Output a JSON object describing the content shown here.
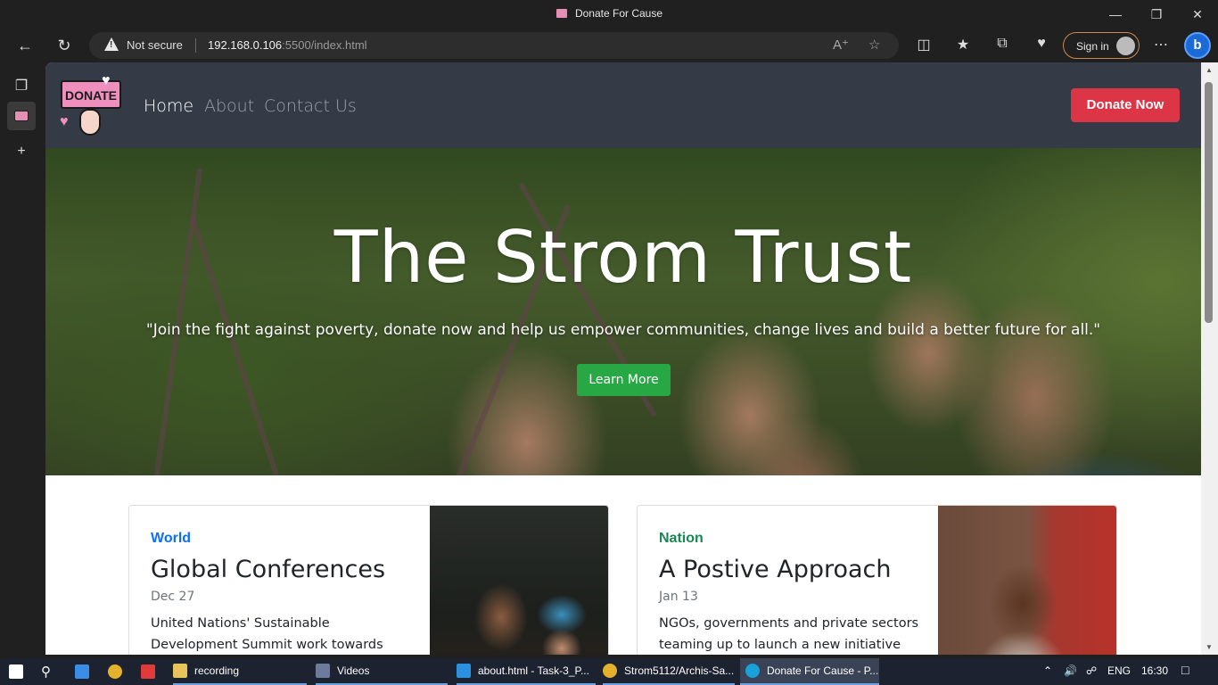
{
  "browser": {
    "window_title": "Donate For Cause",
    "security_label": "Not secure",
    "url_host": "192.168.0.106",
    "url_rest": ":5500/index.html",
    "signin_label": "Sign in"
  },
  "site": {
    "logo_text": "DONATE",
    "nav": [
      {
        "label": "Home",
        "active": true
      },
      {
        "label": "About",
        "active": false
      },
      {
        "label": "Contact Us",
        "active": false
      }
    ],
    "cta_label": "Donate Now"
  },
  "hero": {
    "title": "The Strom Trust",
    "quote": "\"Join the fight against poverty, donate now and help us empower communities, change lives and build a better future for all.\"",
    "button_label": "Learn More"
  },
  "cards": [
    {
      "category": "World",
      "category_color": "#0d6efd",
      "title": "Global Conferences",
      "date": "Dec 27",
      "text": "United Nations' Sustainable Development Summit work towards setting goals and"
    },
    {
      "category": "Nation",
      "category_color": "#198754",
      "title": "A Postive Approach",
      "date": "Jan 13",
      "text": "NGOs, governments and private sectors teaming up to launch a new initiative"
    }
  ],
  "taskbar": {
    "items": [
      {
        "label": "recording"
      },
      {
        "label": "Videos"
      },
      {
        "label": "about.html - Task-3_P..."
      },
      {
        "label": "Strom5112/Archis-Sa..."
      },
      {
        "label": "Donate For Cause - P..."
      }
    ],
    "language": "ENG",
    "time": "16:30"
  },
  "colors": {
    "accent_red": "#dc3545",
    "accent_green": "#28a745",
    "nav_bg": "#343a46"
  }
}
